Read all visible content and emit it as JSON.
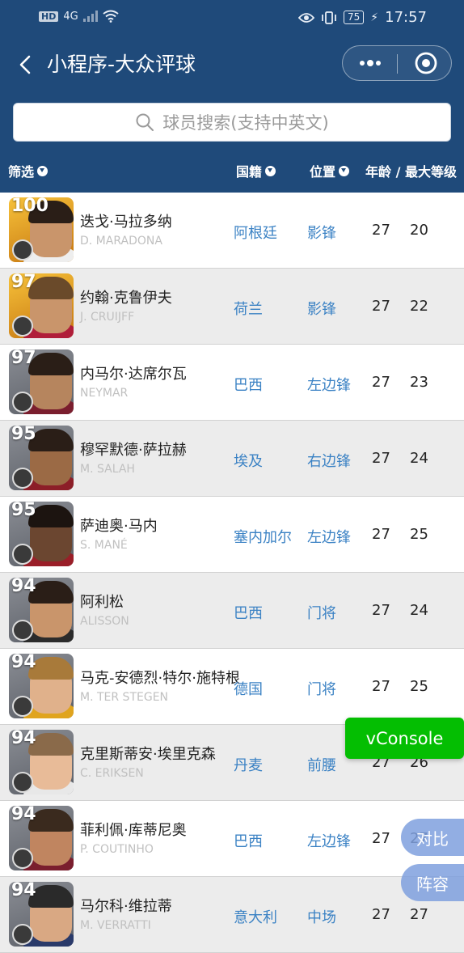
{
  "status_bar": {
    "network": "HD",
    "signal": "4G",
    "battery": "75",
    "time": "17:57"
  },
  "nav": {
    "title": "小程序-大众评球"
  },
  "search": {
    "placeholder": "球员搜索(支持中英文)"
  },
  "filter_bar": {
    "filter_label": "筛选",
    "nationality_label": "国籍",
    "position_label": "位置",
    "age_level_label": "年龄 / 最大等级"
  },
  "players": [
    {
      "rating": "100",
      "name": "迭戈·马拉多纳",
      "ename": "D. MARADONA",
      "nation": "阿根廷",
      "position": "影锋",
      "age": "27",
      "level": "20",
      "card": "gold"
    },
    {
      "rating": "97",
      "name": "约翰·克鲁伊夫",
      "ename": "J. CRUIJFF",
      "nation": "荷兰",
      "position": "影锋",
      "age": "27",
      "level": "22",
      "card": "gold"
    },
    {
      "rating": "97",
      "name": "内马尔·达席尔瓦",
      "ename": "NEYMAR",
      "nation": "巴西",
      "position": "左边锋",
      "age": "27",
      "level": "23",
      "card": "black"
    },
    {
      "rating": "95",
      "name": "穆罕默德·萨拉赫",
      "ename": "M. SALAH",
      "nation": "埃及",
      "position": "右边锋",
      "age": "27",
      "level": "24",
      "card": "black"
    },
    {
      "rating": "95",
      "name": "萨迪奥·马内",
      "ename": "S. MANÉ",
      "nation": "塞内加尔",
      "position": "左边锋",
      "age": "27",
      "level": "25",
      "card": "black"
    },
    {
      "rating": "94",
      "name": "阿利松",
      "ename": "ALISSON",
      "nation": "巴西",
      "position": "门将",
      "age": "27",
      "level": "24",
      "card": "black"
    },
    {
      "rating": "94",
      "name": "马克-安德烈·特尔·施特根",
      "ename": "M. TER STEGEN",
      "nation": "德国",
      "position": "门将",
      "age": "27",
      "level": "25",
      "card": "black"
    },
    {
      "rating": "94",
      "name": "克里斯蒂安·埃里克森",
      "ename": "C. ERIKSEN",
      "nation": "丹麦",
      "position": "前腰",
      "age": "27",
      "level": "26",
      "card": "black"
    },
    {
      "rating": "94",
      "name": "菲利佩·库蒂尼奥",
      "ename": "P. COUTINHO",
      "nation": "巴西",
      "position": "左边锋",
      "age": "27",
      "level": "27",
      "card": "black"
    },
    {
      "rating": "94",
      "name": "马尔科·维拉蒂",
      "ename": "M. VERRATTI",
      "nation": "意大利",
      "position": "中场",
      "age": "27",
      "level": "27",
      "card": "black"
    }
  ],
  "floating": {
    "vconsole": "vConsole",
    "compare": "对比",
    "lineup": "阵容"
  },
  "colors": {
    "header_bg": "#1f4a7a",
    "link_blue": "#3b82c4",
    "vconsole_green": "#04be02",
    "float_btn": "#7fa0de"
  }
}
